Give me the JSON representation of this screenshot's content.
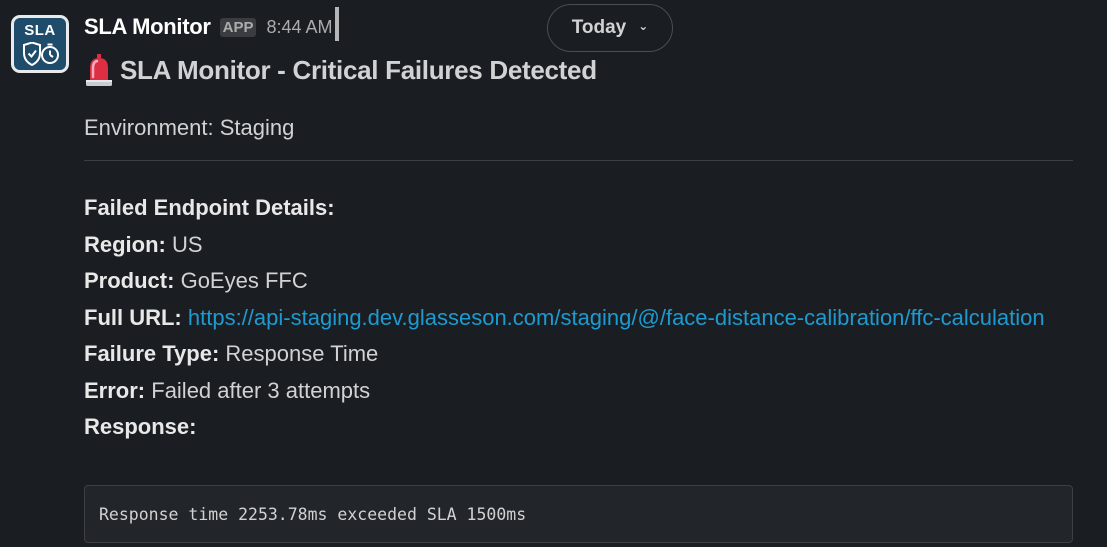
{
  "avatar": {
    "text": "SLA",
    "icon": "shield-stopwatch-icon"
  },
  "header": {
    "sender": "SLA Monitor",
    "badge": "APP",
    "timestamp": "8:44 AM"
  },
  "date_pill": {
    "label": "Today",
    "icon": "chevron-down-icon"
  },
  "message": {
    "title_icon": "rotating-light-icon",
    "title": "SLA Monitor - Critical Failures Detected",
    "environment": "Environment: Staging",
    "details_heading": "Failed Endpoint Details:",
    "region_label": "Region:",
    "region_value": "US",
    "product_label": "Product:",
    "product_value": "GoEyes FFC",
    "url_label": "Full URL:",
    "url_value": "https://api-staging.dev.glasseson.com/staging/@/face-distance-calibration/ffc-calculation",
    "failure_type_label": "Failure Type:",
    "failure_type_value": "Response Time",
    "error_label": "Error:",
    "error_value": "Failed after 3 attempts",
    "response_label": "Response:",
    "response_code": "Response time 2253.78ms exceeded SLA 1500ms"
  },
  "colors": {
    "background": "#1a1d21",
    "text": "#d1d2d3",
    "link": "#1d9bd1",
    "code_background": "#222529"
  }
}
